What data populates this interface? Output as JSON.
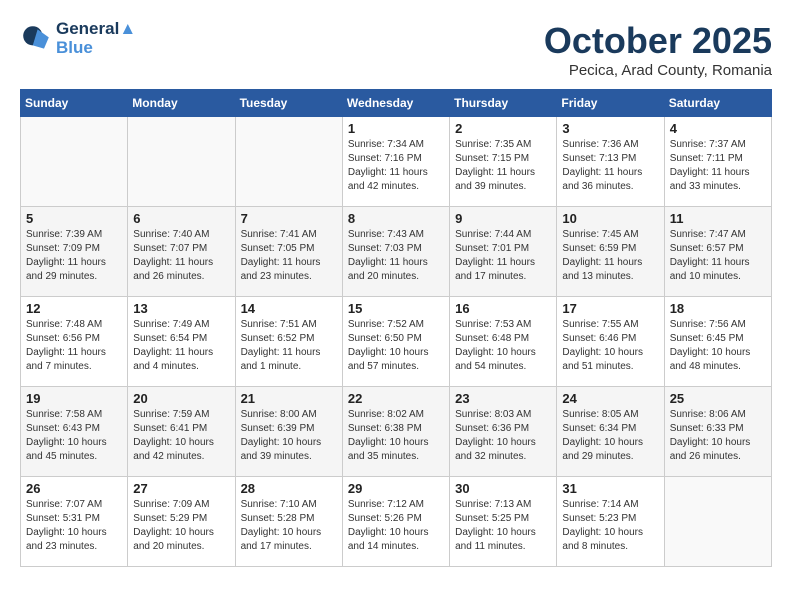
{
  "header": {
    "logo_line1": "General",
    "logo_line2": "Blue",
    "month_title": "October 2025",
    "subtitle": "Pecica, Arad County, Romania"
  },
  "weekdays": [
    "Sunday",
    "Monday",
    "Tuesday",
    "Wednesday",
    "Thursday",
    "Friday",
    "Saturday"
  ],
  "weeks": [
    [
      {
        "day": "",
        "info": ""
      },
      {
        "day": "",
        "info": ""
      },
      {
        "day": "",
        "info": ""
      },
      {
        "day": "1",
        "info": "Sunrise: 7:34 AM\nSunset: 7:16 PM\nDaylight: 11 hours and 42 minutes."
      },
      {
        "day": "2",
        "info": "Sunrise: 7:35 AM\nSunset: 7:15 PM\nDaylight: 11 hours and 39 minutes."
      },
      {
        "day": "3",
        "info": "Sunrise: 7:36 AM\nSunset: 7:13 PM\nDaylight: 11 hours and 36 minutes."
      },
      {
        "day": "4",
        "info": "Sunrise: 7:37 AM\nSunset: 7:11 PM\nDaylight: 11 hours and 33 minutes."
      }
    ],
    [
      {
        "day": "5",
        "info": "Sunrise: 7:39 AM\nSunset: 7:09 PM\nDaylight: 11 hours and 29 minutes."
      },
      {
        "day": "6",
        "info": "Sunrise: 7:40 AM\nSunset: 7:07 PM\nDaylight: 11 hours and 26 minutes."
      },
      {
        "day": "7",
        "info": "Sunrise: 7:41 AM\nSunset: 7:05 PM\nDaylight: 11 hours and 23 minutes."
      },
      {
        "day": "8",
        "info": "Sunrise: 7:43 AM\nSunset: 7:03 PM\nDaylight: 11 hours and 20 minutes."
      },
      {
        "day": "9",
        "info": "Sunrise: 7:44 AM\nSunset: 7:01 PM\nDaylight: 11 hours and 17 minutes."
      },
      {
        "day": "10",
        "info": "Sunrise: 7:45 AM\nSunset: 6:59 PM\nDaylight: 11 hours and 13 minutes."
      },
      {
        "day": "11",
        "info": "Sunrise: 7:47 AM\nSunset: 6:57 PM\nDaylight: 11 hours and 10 minutes."
      }
    ],
    [
      {
        "day": "12",
        "info": "Sunrise: 7:48 AM\nSunset: 6:56 PM\nDaylight: 11 hours and 7 minutes."
      },
      {
        "day": "13",
        "info": "Sunrise: 7:49 AM\nSunset: 6:54 PM\nDaylight: 11 hours and 4 minutes."
      },
      {
        "day": "14",
        "info": "Sunrise: 7:51 AM\nSunset: 6:52 PM\nDaylight: 11 hours and 1 minute."
      },
      {
        "day": "15",
        "info": "Sunrise: 7:52 AM\nSunset: 6:50 PM\nDaylight: 10 hours and 57 minutes."
      },
      {
        "day": "16",
        "info": "Sunrise: 7:53 AM\nSunset: 6:48 PM\nDaylight: 10 hours and 54 minutes."
      },
      {
        "day": "17",
        "info": "Sunrise: 7:55 AM\nSunset: 6:46 PM\nDaylight: 10 hours and 51 minutes."
      },
      {
        "day": "18",
        "info": "Sunrise: 7:56 AM\nSunset: 6:45 PM\nDaylight: 10 hours and 48 minutes."
      }
    ],
    [
      {
        "day": "19",
        "info": "Sunrise: 7:58 AM\nSunset: 6:43 PM\nDaylight: 10 hours and 45 minutes."
      },
      {
        "day": "20",
        "info": "Sunrise: 7:59 AM\nSunset: 6:41 PM\nDaylight: 10 hours and 42 minutes."
      },
      {
        "day": "21",
        "info": "Sunrise: 8:00 AM\nSunset: 6:39 PM\nDaylight: 10 hours and 39 minutes."
      },
      {
        "day": "22",
        "info": "Sunrise: 8:02 AM\nSunset: 6:38 PM\nDaylight: 10 hours and 35 minutes."
      },
      {
        "day": "23",
        "info": "Sunrise: 8:03 AM\nSunset: 6:36 PM\nDaylight: 10 hours and 32 minutes."
      },
      {
        "day": "24",
        "info": "Sunrise: 8:05 AM\nSunset: 6:34 PM\nDaylight: 10 hours and 29 minutes."
      },
      {
        "day": "25",
        "info": "Sunrise: 8:06 AM\nSunset: 6:33 PM\nDaylight: 10 hours and 26 minutes."
      }
    ],
    [
      {
        "day": "26",
        "info": "Sunrise: 7:07 AM\nSunset: 5:31 PM\nDaylight: 10 hours and 23 minutes."
      },
      {
        "day": "27",
        "info": "Sunrise: 7:09 AM\nSunset: 5:29 PM\nDaylight: 10 hours and 20 minutes."
      },
      {
        "day": "28",
        "info": "Sunrise: 7:10 AM\nSunset: 5:28 PM\nDaylight: 10 hours and 17 minutes."
      },
      {
        "day": "29",
        "info": "Sunrise: 7:12 AM\nSunset: 5:26 PM\nDaylight: 10 hours and 14 minutes."
      },
      {
        "day": "30",
        "info": "Sunrise: 7:13 AM\nSunset: 5:25 PM\nDaylight: 10 hours and 11 minutes."
      },
      {
        "day": "31",
        "info": "Sunrise: 7:14 AM\nSunset: 5:23 PM\nDaylight: 10 hours and 8 minutes."
      },
      {
        "day": "",
        "info": ""
      }
    ]
  ]
}
